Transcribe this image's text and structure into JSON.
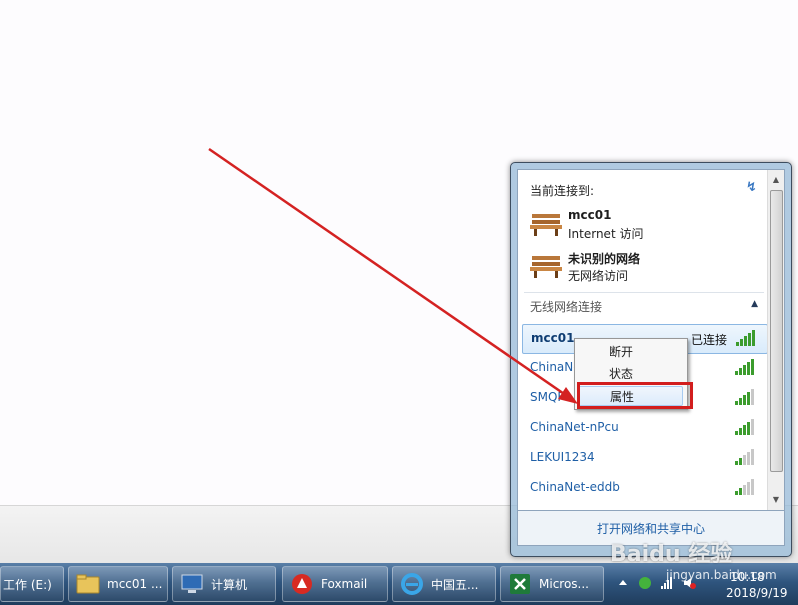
{
  "flyout": {
    "current_heading": "当前连接到:",
    "connections": [
      {
        "name": "mcc01",
        "status": "Internet 访问"
      },
      {
        "name": "未识别的网络",
        "status": "无网络访问"
      }
    ],
    "wireless_section": "无线网络连接",
    "networks": [
      {
        "ssid": "mcc01",
        "status": "已连接"
      },
      {
        "ssid": "ChinaNet-",
        "status": ""
      },
      {
        "ssid": "SMQF",
        "status": ""
      },
      {
        "ssid": "ChinaNet-nPcu",
        "status": ""
      },
      {
        "ssid": "LEKUI1234",
        "status": ""
      },
      {
        "ssid": "ChinaNet-eddb",
        "status": ""
      }
    ],
    "footer_link": "打开网络和共享中心"
  },
  "context_menu": {
    "items": [
      "断开",
      "状态",
      "属性"
    ]
  },
  "taskbar": {
    "items": [
      {
        "label": "工作 (E:)",
        "icon": "folder-icon"
      },
      {
        "label": "mcc01 ...",
        "icon": "folder-icon"
      },
      {
        "label": "计算机",
        "icon": "computer-icon"
      },
      {
        "label": "Foxmail",
        "icon": "foxmail-icon"
      },
      {
        "label": "中国五...",
        "icon": "ie-icon"
      },
      {
        "label": "Micros...",
        "icon": "excel-icon"
      }
    ],
    "clock": {
      "time": "10:18",
      "date": "2018/9/19"
    }
  },
  "watermark": {
    "logo": "Baidu 经验",
    "url": "jingyan.baidu.com"
  },
  "colors": {
    "highlight": "#d21d1d",
    "link": "#1f5fa6",
    "taskbar": "#2f557e"
  }
}
